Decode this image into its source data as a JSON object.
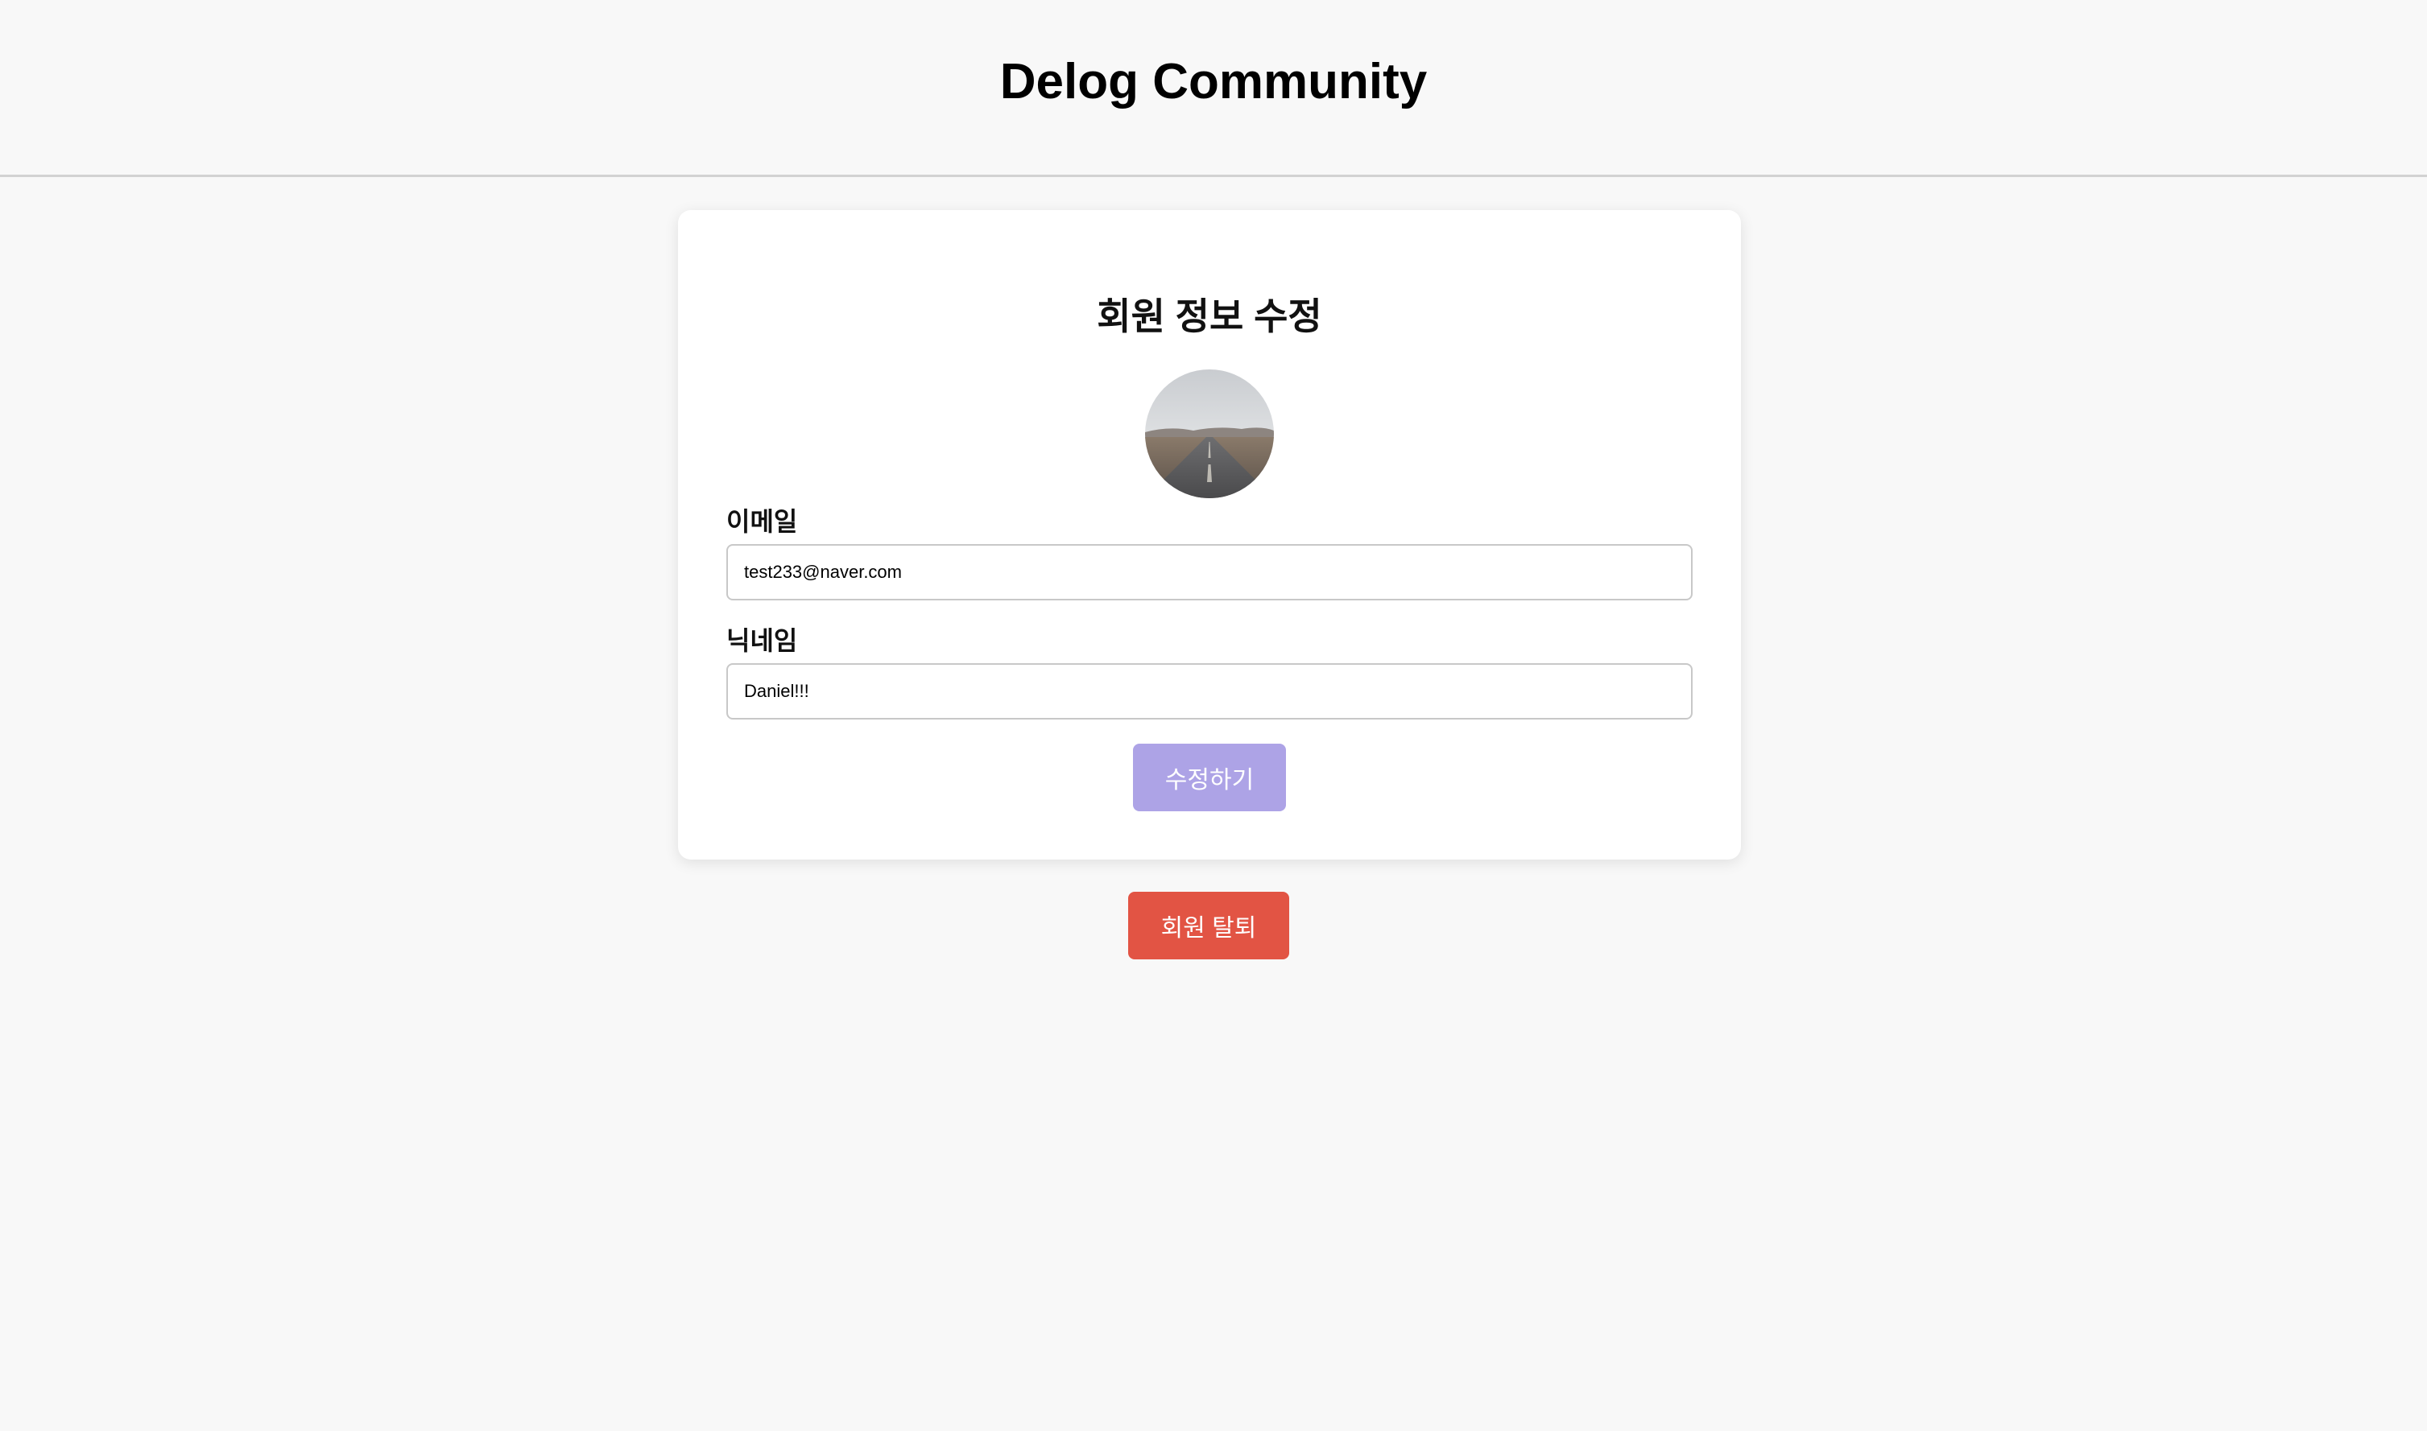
{
  "header": {
    "title": "Delog Community"
  },
  "profile_form": {
    "title": "회원 정보 수정",
    "email": {
      "label": "이메일",
      "value": "test233@naver.com"
    },
    "nickname": {
      "label": "닉네임",
      "value": "Daniel!!!"
    },
    "submit_label": "수정하기"
  },
  "withdraw_label": "회원 탈퇴",
  "colors": {
    "background": "#f8f8f8",
    "card": "#ffffff",
    "submit_button": "#ada3e6",
    "withdraw_button": "#e25444"
  }
}
